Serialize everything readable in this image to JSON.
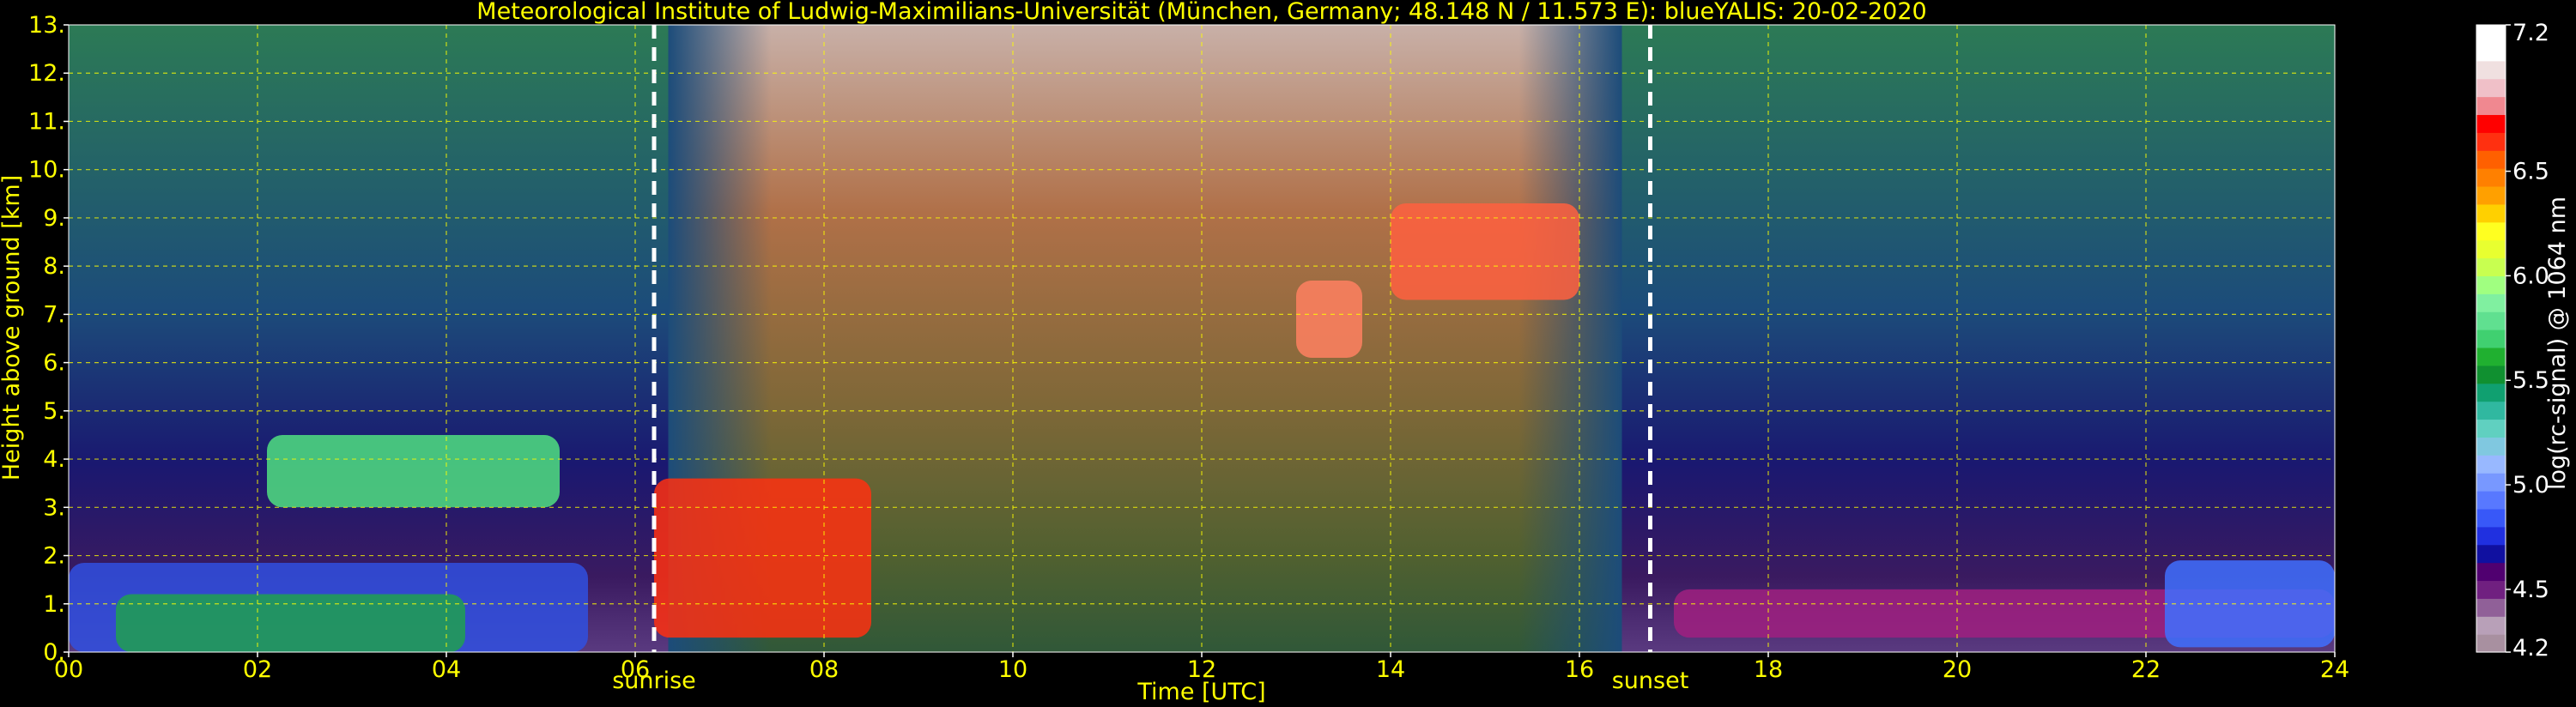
{
  "chart_data": {
    "type": "heatmap",
    "title": "Meteorological Institute of Ludwig-Maximilians-Universität (München, Germany; 48.148 N / 11.573 E):    blueYALIS: 20-02-2020",
    "xlabel": "Time [UTC]",
    "ylabel": "Height above ground [km]",
    "xlim": [
      0,
      24
    ],
    "ylim": [
      0,
      13
    ],
    "x_ticks": [
      {
        "value": 0,
        "label": "00"
      },
      {
        "value": 2,
        "label": "02"
      },
      {
        "value": 4,
        "label": "04"
      },
      {
        "value": 6,
        "label": "06"
      },
      {
        "value": 8,
        "label": "08"
      },
      {
        "value": 10,
        "label": "10"
      },
      {
        "value": 12,
        "label": "12"
      },
      {
        "value": 14,
        "label": "14"
      },
      {
        "value": 16,
        "label": "16"
      },
      {
        "value": 18,
        "label": "18"
      },
      {
        "value": 20,
        "label": "20"
      },
      {
        "value": 22,
        "label": "22"
      },
      {
        "value": 24,
        "label": "24"
      }
    ],
    "y_ticks": [
      {
        "value": 0,
        "label": "0."
      },
      {
        "value": 1,
        "label": "1."
      },
      {
        "value": 2,
        "label": "2."
      },
      {
        "value": 3,
        "label": "3."
      },
      {
        "value": 4,
        "label": "4."
      },
      {
        "value": 5,
        "label": "5."
      },
      {
        "value": 6,
        "label": "6."
      },
      {
        "value": 7,
        "label": "7."
      },
      {
        "value": 8,
        "label": "8."
      },
      {
        "value": 9,
        "label": "9."
      },
      {
        "value": 10,
        "label": "10."
      },
      {
        "value": 11,
        "label": "11."
      },
      {
        "value": 12,
        "label": "12."
      },
      {
        "value": 13,
        "label": "13."
      }
    ],
    "grid": true,
    "grid_color": "#ffff00",
    "annotations": [
      {
        "label": "sunrise",
        "x": 6.2
      },
      {
        "label": "sunset",
        "x": 16.75
      }
    ],
    "colorbar": {
      "label": "log(rc-signal) @ 1064 nm",
      "range": [
        4.2,
        7.2
      ],
      "ticks": [
        {
          "value": 4.2,
          "label": "4.2"
        },
        {
          "value": 4.5,
          "label": "4.5"
        },
        {
          "value": 5.0,
          "label": "5.0"
        },
        {
          "value": 5.5,
          "label": "5.5"
        },
        {
          "value": 6.0,
          "label": "6.0"
        },
        {
          "value": 6.5,
          "label": "6.5"
        },
        {
          "value": 7.2,
          "label": "7.2"
        }
      ],
      "colors": [
        "#a890a0",
        "#b8a0b8",
        "#906098",
        "#702080",
        "#500070",
        "#1010a0",
        "#2030e0",
        "#3858f8",
        "#5878ff",
        "#7898ff",
        "#98b8ff",
        "#80c8e0",
        "#60d0c0",
        "#30b8a0",
        "#10a070",
        "#109030",
        "#20b030",
        "#40d070",
        "#60e090",
        "#80f0a0",
        "#a0ff80",
        "#c8ff50",
        "#e8ff30",
        "#ffff20",
        "#ffd000",
        "#ffa000",
        "#ff8000",
        "#ff6000",
        "#ff3010",
        "#ff0000",
        "#f08890",
        "#f0c0c8",
        "#f0e0e0",
        "#ffffff",
        "#ffffff"
      ]
    },
    "features": [
      {
        "kind": "boundary_layer",
        "start": 0,
        "end": 5.5,
        "top": 1.85,
        "color": "#3050e0"
      },
      {
        "kind": "boundary_layer_inner",
        "start": 0.5,
        "end": 4.2,
        "top": 1.2,
        "color": "#20a050"
      },
      {
        "kind": "cloud",
        "start": 6.2,
        "end": 8.5,
        "bottom": 0.3,
        "top": 3.6,
        "color": "#ff3010"
      },
      {
        "kind": "cloud",
        "start": 2.1,
        "end": 5.2,
        "bottom": 3.0,
        "top": 4.5,
        "color": "#50e080"
      },
      {
        "kind": "cirrus",
        "start": 13.0,
        "end": 13.7,
        "bottom": 6.1,
        "top": 7.7,
        "color": "#ff8060"
      },
      {
        "kind": "cirrus",
        "start": 14.0,
        "end": 16.0,
        "bottom": 7.3,
        "top": 9.3,
        "color": "#ff6040"
      },
      {
        "kind": "residual_layer",
        "start": 17.0,
        "end": 24.0,
        "bottom": 0.3,
        "top": 1.3,
        "color": "#a02080"
      },
      {
        "kind": "boundary_layer",
        "start": 22.2,
        "end": 24.0,
        "bottom": 0.1,
        "top": 1.9,
        "color": "#4070ff"
      }
    ]
  }
}
